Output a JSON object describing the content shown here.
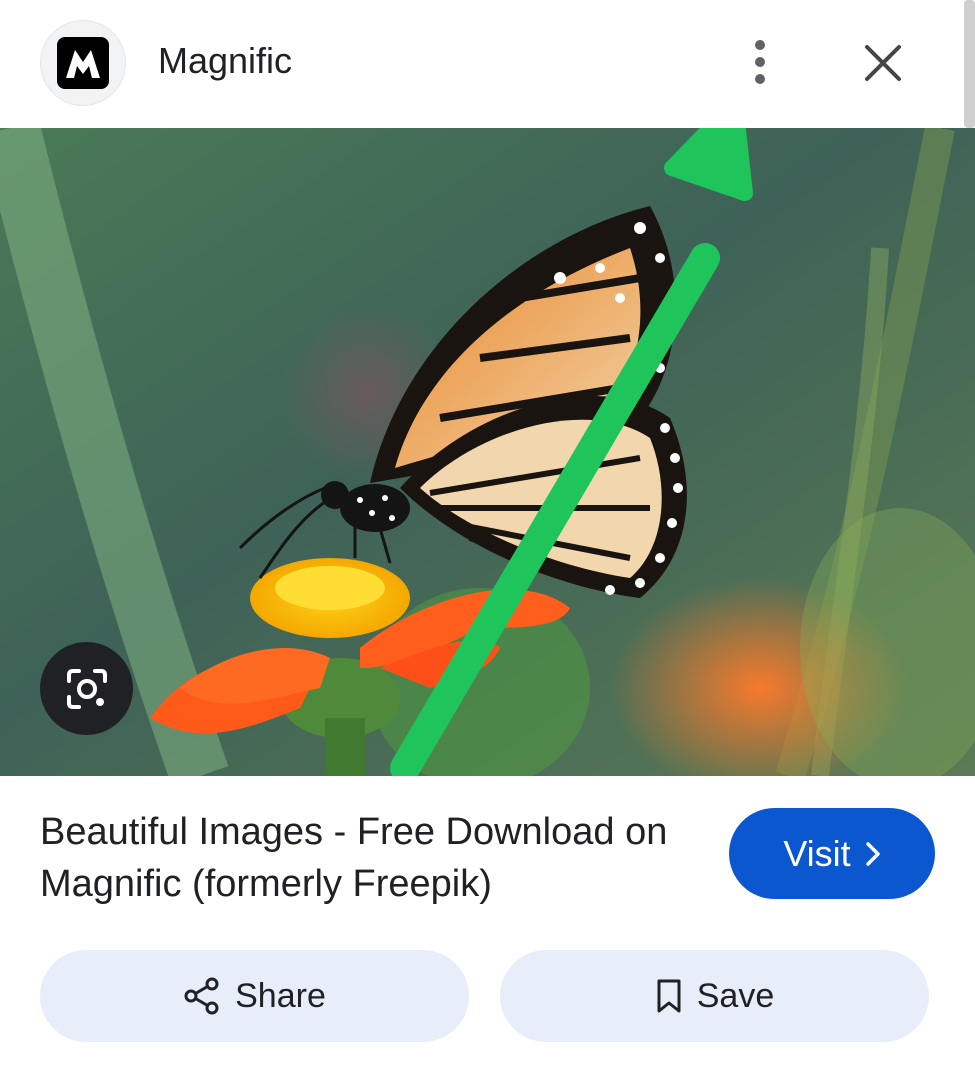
{
  "header": {
    "site_name": "Magnific",
    "logo_letter": "M",
    "more_icon": "more-vert-icon",
    "close_icon": "close-icon"
  },
  "image": {
    "subject": "monarch-butterfly-on-orange-flower",
    "annotation_arrow_color": "#1fc45a"
  },
  "lens": {
    "icon": "google-lens-icon"
  },
  "result": {
    "title": "Beautiful Images - Free Download on Magnific (formerly Freepik)",
    "visit_label": "Visit"
  },
  "actions": {
    "share_label": "Share",
    "save_label": "Save"
  },
  "colors": {
    "accent": "#0b57d0",
    "pill_bg": "#e8eef9",
    "lens_bg": "#202124"
  }
}
